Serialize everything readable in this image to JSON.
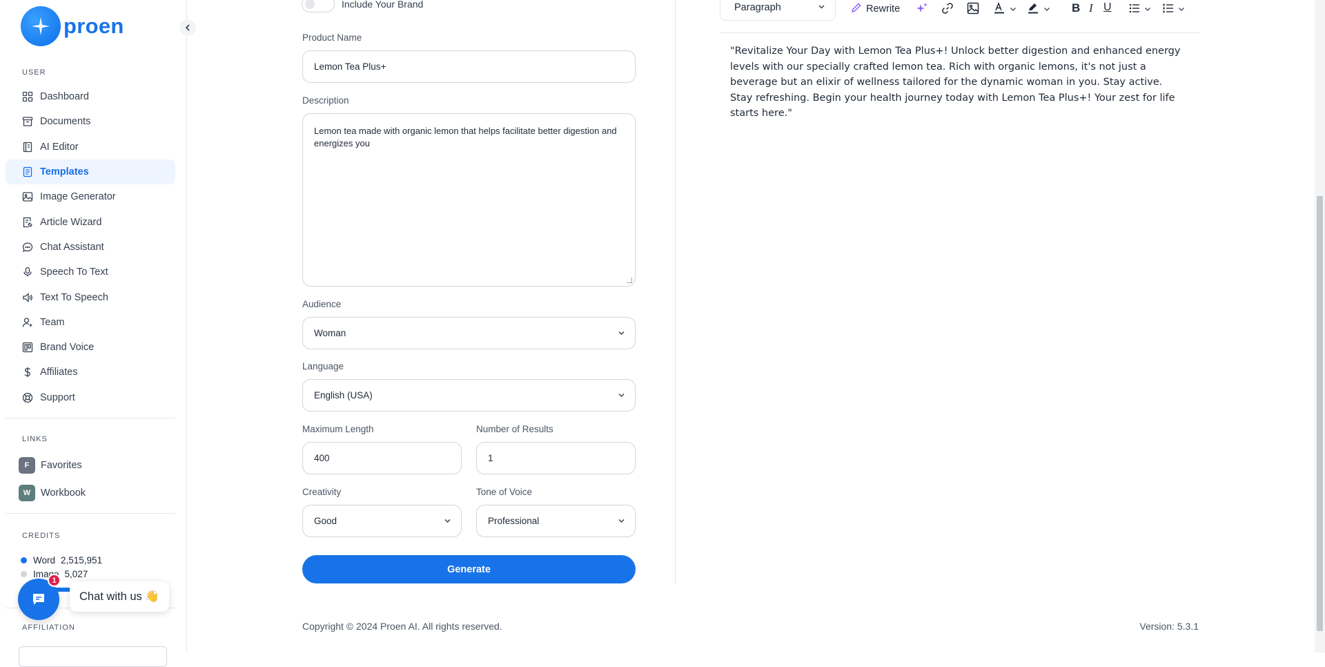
{
  "app": {
    "logo_text": "proen"
  },
  "sidebar": {
    "user_label": "USER",
    "items": [
      {
        "label": "Dashboard",
        "icon": "grid-icon"
      },
      {
        "label": "Documents",
        "icon": "archive-icon"
      },
      {
        "label": "AI Editor",
        "icon": "notebook-icon"
      },
      {
        "label": "Templates",
        "icon": "file-text-icon",
        "active": true
      },
      {
        "label": "Image Generator",
        "icon": "image-icon"
      },
      {
        "label": "Article Wizard",
        "icon": "document-edit-icon"
      },
      {
        "label": "Chat Assistant",
        "icon": "message-icon"
      },
      {
        "label": "Speech To Text",
        "icon": "microphone-icon"
      },
      {
        "label": "Text To Speech",
        "icon": "volume-icon"
      },
      {
        "label": "Team",
        "icon": "user-plus-icon"
      },
      {
        "label": "Brand Voice",
        "icon": "brand-icon"
      },
      {
        "label": "Affiliates",
        "icon": "dollar-icon"
      },
      {
        "label": "Support",
        "icon": "lifebuoy-icon"
      }
    ],
    "links_label": "LINKS",
    "links": [
      {
        "badge": "F",
        "label": "Favorites",
        "color": "#6b7280"
      },
      {
        "badge": "W",
        "label": "Workbook",
        "color": "#5f7d7e"
      }
    ],
    "credits_label": "CREDITS",
    "credits": [
      {
        "label": "Word",
        "value": "2,515,951",
        "color": "#1873e8"
      },
      {
        "label": "Image",
        "value": "5,027",
        "color": "#d1d5db"
      }
    ],
    "credit_progress": 0.4,
    "affiliation_label": "AFFILIATION",
    "chat": {
      "label": "Chat with us 👋",
      "count": "1"
    }
  },
  "form": {
    "toggle_label": "Include Your Brand",
    "product_name": {
      "label": "Product Name",
      "value": "Lemon Tea Plus+"
    },
    "description": {
      "label": "Description",
      "value": "Lemon tea made with organic lemon that helps facilitate better digestion and energizes you"
    },
    "audience": {
      "label": "Audience",
      "value": "Woman"
    },
    "language": {
      "label": "Language",
      "value": "English (USA)"
    },
    "max_length": {
      "label": "Maximum Length",
      "value": "400"
    },
    "num_results": {
      "label": "Number of Results",
      "value": "1"
    },
    "creativity": {
      "label": "Creativity",
      "value": "Good"
    },
    "tone": {
      "label": "Tone of Voice",
      "value": "Professional"
    },
    "generate_label": "Generate"
  },
  "editor": {
    "paragraph_label": "Paragraph",
    "rewrite_label": "Rewrite",
    "content": "\"Revitalize Your Day with Lemon Tea Plus+! Unlock better digestion and enhanced energy levels with our specially crafted lemon tea. Rich with organic lemons, it's not just a beverage but an elixir of wellness tailored for the dynamic woman in you. Stay active. Stay refreshing. Begin your health journey today with Lemon Tea Plus+! Your zest for life starts here.\""
  },
  "footer": {
    "copyright": "Copyright © 2024 Proen AI. All rights reserved.",
    "version": "Version: 5.3.1"
  }
}
